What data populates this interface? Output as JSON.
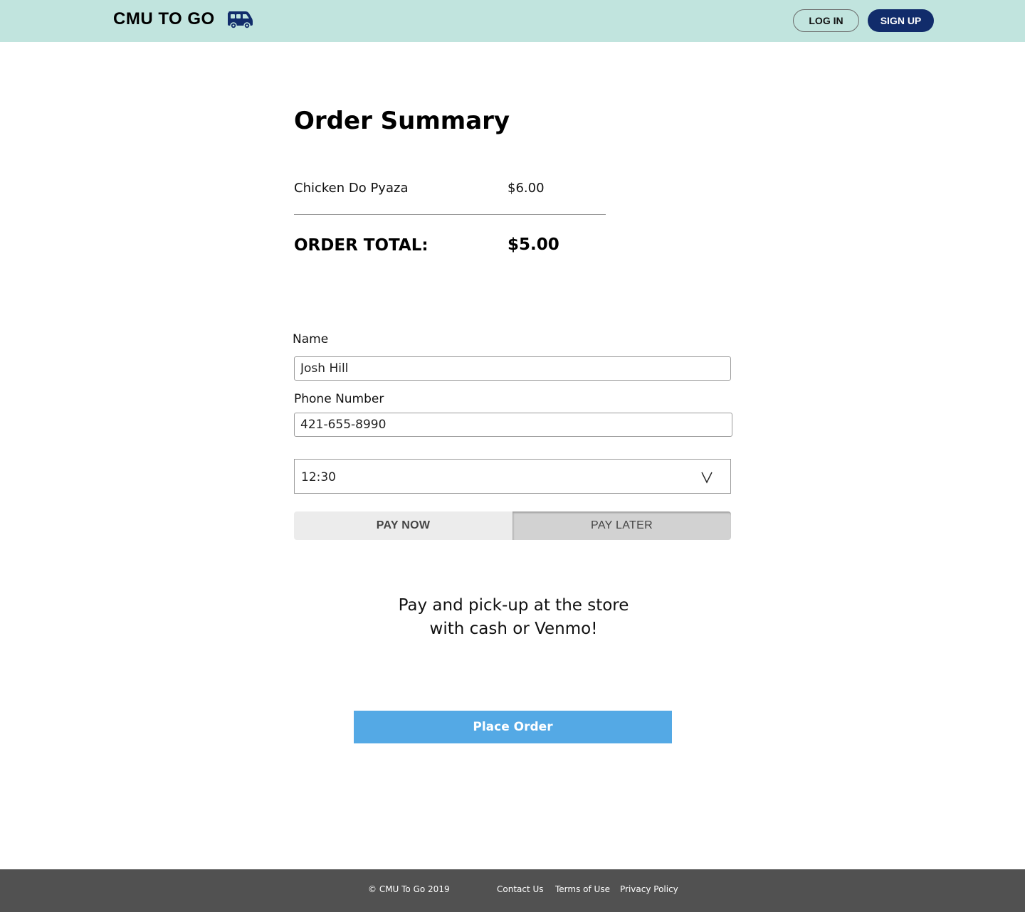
{
  "header": {
    "brand": "CMU TO GO",
    "brand_icon": "van-icon",
    "login_label": "LOG IN",
    "signup_label": "SIGN UP"
  },
  "summary": {
    "title": "Order Summary",
    "items": [
      {
        "name": "Chicken Do Pyaza",
        "price": "$6.00"
      }
    ],
    "total_label": "ORDER TOTAL:",
    "total_value": "$5.00"
  },
  "form": {
    "name_label": "Name",
    "name_value": "Josh Hill",
    "phone_label": "Phone Number",
    "phone_value": "421-655-8990",
    "pickup_time": "12:30",
    "pay_now_label": "PAY NOW",
    "pay_later_label": "PAY LATER",
    "selected_payment": "PAY LATER"
  },
  "note": {
    "line1": "Pay and pick-up at the store",
    "line2": "with cash or Venmo!"
  },
  "place_order_label": "Place Order",
  "footer": {
    "copyright": "© CMU To Go 2019",
    "contact": "Contact Us",
    "terms": "Terms of Use",
    "privacy": "Privacy Policy"
  },
  "colors": {
    "header_bg": "#c1e4de",
    "brand_navy": "#112c6b",
    "button_blue": "#54a9e5",
    "footer_bg": "#515151"
  }
}
